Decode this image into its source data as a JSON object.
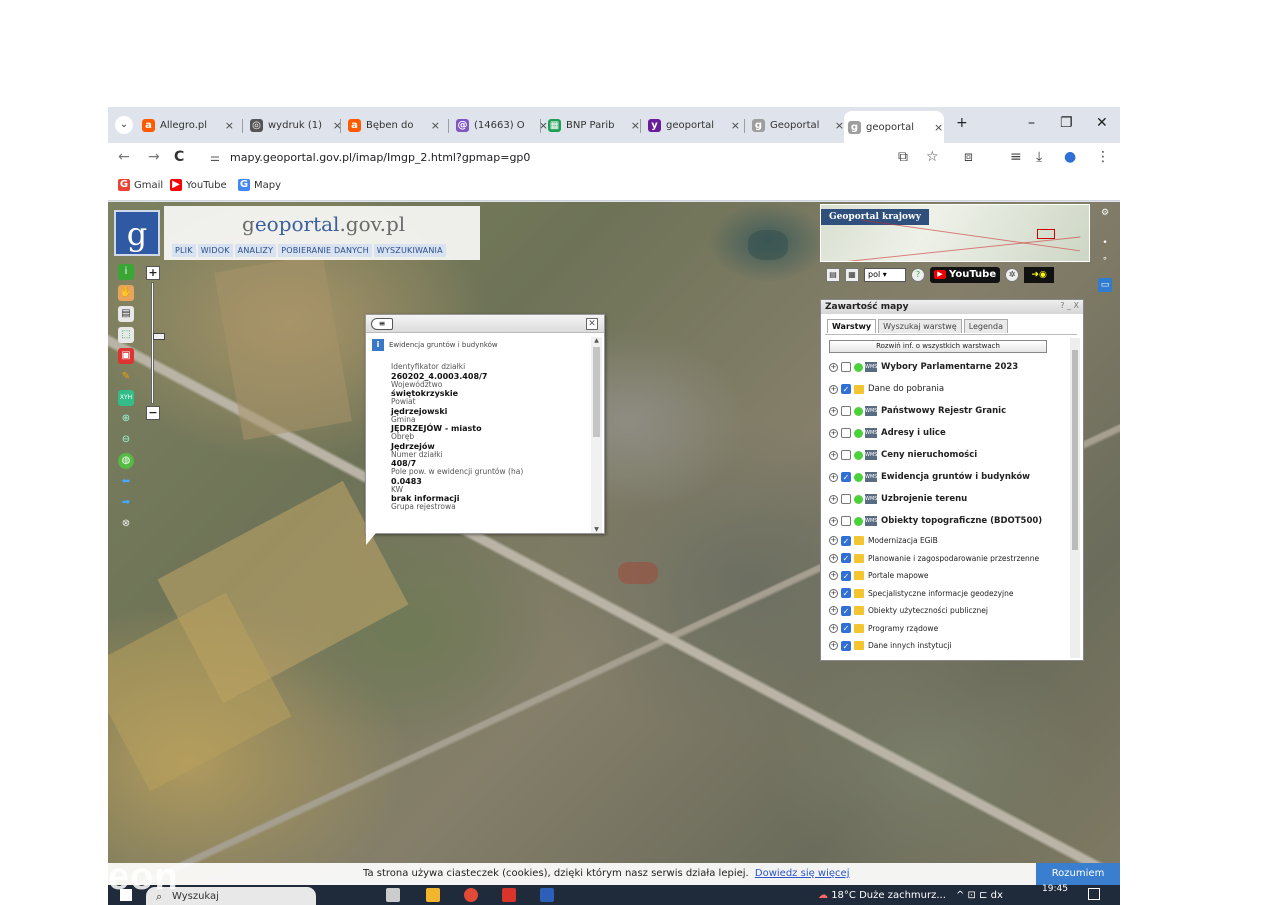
{
  "browser": {
    "tabs": [
      {
        "label": "Allegro.pl",
        "favicon_color": "#ff5a00",
        "favicon_glyph": "a"
      },
      {
        "label": "wydruk (1)",
        "favicon_color": "#555555",
        "favicon_glyph": "◎"
      },
      {
        "label": "Bęben do",
        "favicon_color": "#ff5a00",
        "favicon_glyph": "a"
      },
      {
        "label": "(14663) O",
        "favicon_color": "#7e57c2",
        "favicon_glyph": "@"
      },
      {
        "label": "BNP Parib",
        "favicon_color": "#1e9e57",
        "favicon_glyph": "▦"
      },
      {
        "label": "geoportal",
        "favicon_color": "#6a1b9a",
        "favicon_glyph": "y"
      },
      {
        "label": "Geoportal",
        "favicon_color": "#9e9e9e",
        "favicon_glyph": "g"
      },
      {
        "label": "geoportal",
        "favicon_color": "#9e9e9e",
        "favicon_glyph": "g",
        "active": true
      }
    ],
    "tab_close_glyph": "×",
    "new_tab_glyph": "+",
    "window_controls": {
      "minimize": "–",
      "restore": "❐",
      "close": "✕"
    },
    "nav": {
      "back": "←",
      "forward": "→",
      "reload": "C"
    },
    "url": "mapy.geoportal.gov.pl/imap/Imgp_2.html?gpmap=gp0",
    "bookmarks": [
      {
        "label": "Gmail",
        "icon": "G",
        "color": "#ea4335"
      },
      {
        "label": "YouTube",
        "icon": "▶",
        "color": "#ff0000"
      },
      {
        "label": "Mapy",
        "icon": "G",
        "color": "#4285f4"
      }
    ]
  },
  "geoportal": {
    "logo_glyph": "g",
    "title_prefix": "g",
    "title_main": "eoportal",
    "title_suffix": ".gov.pl",
    "menu": [
      "PLIK",
      "WIDOK",
      "ANALIZY",
      "POBIERANIE DANYCH",
      "WYSZUKIWANIA"
    ],
    "zoom_in": "+",
    "zoom_out": "−",
    "overview_title": "Geoportal krajowy",
    "language": "pol",
    "youtube_label": "YouTube"
  },
  "popup": {
    "source": "Ewidencja gruntów i budynków",
    "fields": [
      {
        "label": "Identyfikator działki",
        "value": "260202_4.0003.408/7"
      },
      {
        "label": "Województwo",
        "value": "świętokrzyskie"
      },
      {
        "label": "Powiat",
        "value": "jędrzejowski"
      },
      {
        "label": "Gmina",
        "value": "JĘDRZEJÓW - miasto"
      },
      {
        "label": "Obręb",
        "value": "Jędrzejów"
      },
      {
        "label": "Numer działki",
        "value": "408/7"
      },
      {
        "label": "Pole pow. w ewidencji gruntów (ha)",
        "value": "0.0483"
      },
      {
        "label": "KW",
        "value": "brak informacji"
      },
      {
        "label": "Grupa rejestrowa",
        "value": ""
      }
    ]
  },
  "layers_panel": {
    "title": "Zawartość mapy",
    "controls": "? _ X",
    "tabs": [
      "Warstwy",
      "Wyszukaj warstwę",
      "Legenda"
    ],
    "expand_all": "Rozwiń inf. o wszystkich warstwach",
    "layers": [
      {
        "label": "Wybory Parlamentarne 2023",
        "checked": false,
        "type": "wms",
        "bold": true
      },
      {
        "label": "Dane do pobrania",
        "checked": true,
        "type": "folder",
        "bold": false
      },
      {
        "label": "Państwowy Rejestr Granic",
        "checked": false,
        "type": "wms",
        "bold": true
      },
      {
        "label": "Adresy i ulice",
        "checked": false,
        "type": "wms",
        "bold": true
      },
      {
        "label": "Ceny nieruchomości",
        "checked": false,
        "type": "wms",
        "bold": true
      },
      {
        "label": "Ewidencja gruntów i budynków",
        "checked": true,
        "type": "wms",
        "bold": true
      },
      {
        "label": "Uzbrojenie terenu",
        "checked": false,
        "type": "wms",
        "bold": true
      },
      {
        "label": "Obiekty topograficzne (BDOT500)",
        "checked": false,
        "type": "wms",
        "bold": true
      },
      {
        "label": "Modernizacja EGiB",
        "checked": true,
        "type": "folder",
        "bold": false
      },
      {
        "label": "Planowanie i zagospodarowanie przestrzenne",
        "checked": true,
        "type": "folder",
        "bold": false
      },
      {
        "label": "Portale mapowe",
        "checked": true,
        "type": "folder",
        "bold": false
      },
      {
        "label": "Specjalistyczne informacje geodezyjne",
        "checked": true,
        "type": "folder",
        "bold": false
      },
      {
        "label": "Obiekty użyteczności publicznej",
        "checked": true,
        "type": "folder",
        "bold": false
      },
      {
        "label": "Programy rządowe",
        "checked": true,
        "type": "folder",
        "bold": false
      },
      {
        "label": "Dane innych instytucji",
        "checked": true,
        "type": "folder",
        "bold": false
      }
    ]
  },
  "cookie_bar": {
    "text": "Ta strona używa ciasteczek (cookies), dzięki którym nasz serwis działa lepiej.",
    "link": "Dowiedz się więcej",
    "accept": "Rozumiem"
  },
  "taskbar": {
    "search_placeholder": "Wyszukaj",
    "weather": "18°C  Duże zachmurz...",
    "tray": "^ ⊡ ⊏ dx",
    "time": "19:45"
  },
  "watermark": "eon"
}
